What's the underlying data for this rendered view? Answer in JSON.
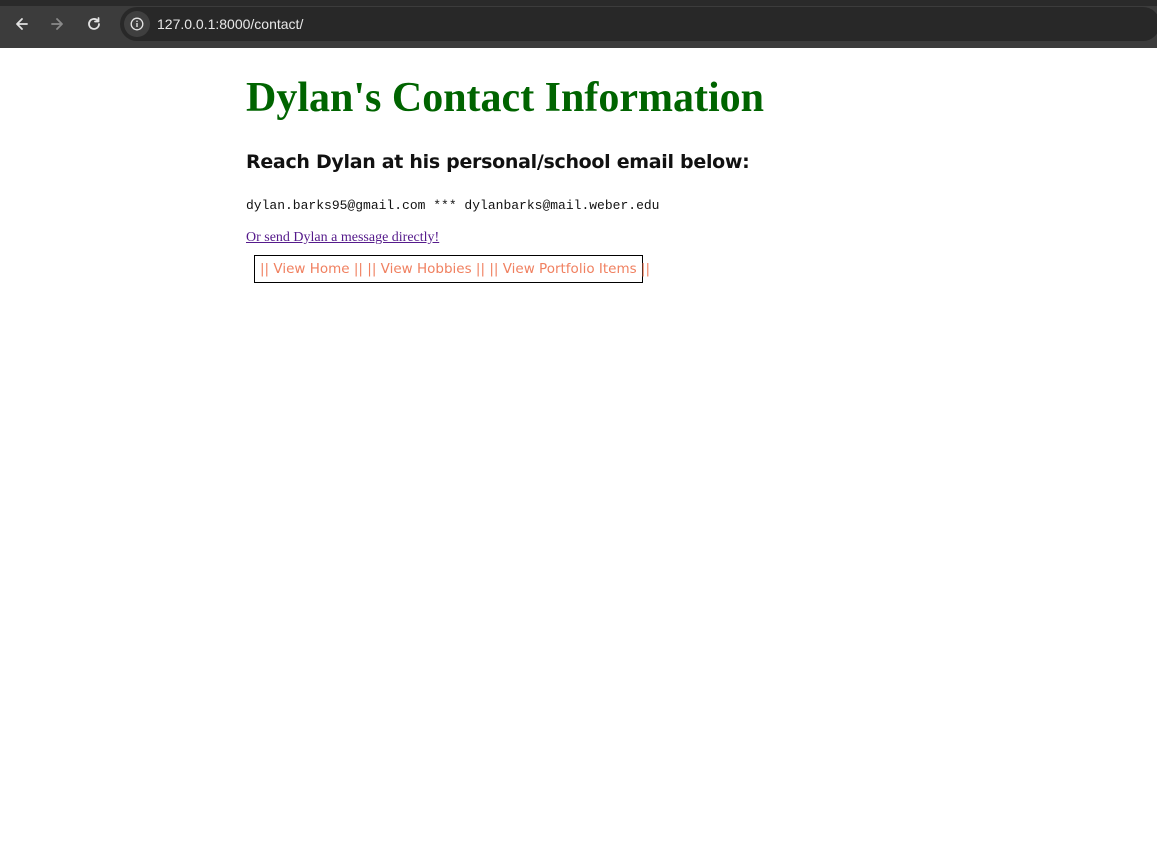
{
  "browser": {
    "url": "127.0.0.1:8000/contact/",
    "back_icon": "arrow-left-icon",
    "forward_icon": "arrow-right-icon",
    "reload_icon": "reload-icon",
    "site_info_icon": "info-icon"
  },
  "page": {
    "title": "Dylan's Contact Information",
    "subtitle": "Reach Dylan at his personal/school email below:",
    "emails": "dylan.barks95@gmail.com *** dylanbarks@mail.weber.edu",
    "message_link": "Or send Dylan a message directly!",
    "nav": {
      "home": "|| View Home ||",
      "hobbies": "|| View Hobbies ||",
      "portfolio": "|| View Portfolio Items ||"
    }
  },
  "colors": {
    "title": "#006400",
    "nav_link": "#f08060",
    "visited_link": "#551a8b"
  }
}
